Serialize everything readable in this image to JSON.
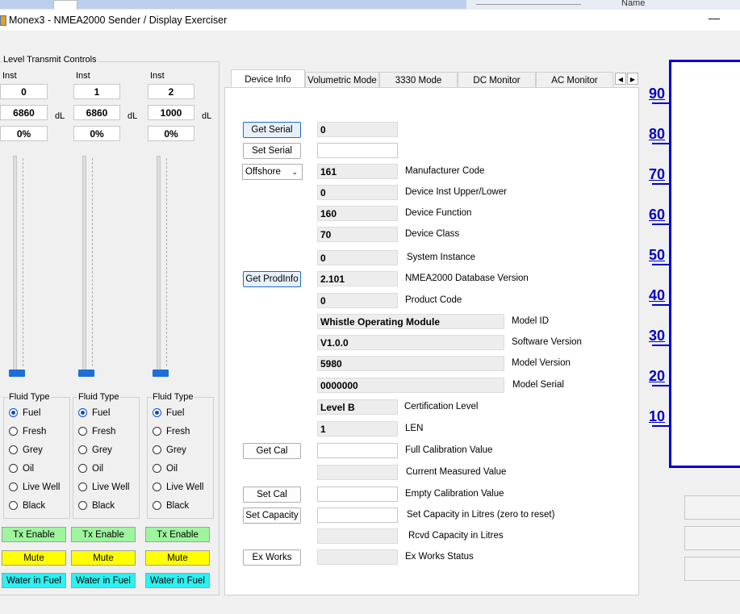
{
  "topbar": {
    "name_header": "Name"
  },
  "window": {
    "title": "Monex3 - NMEA2000 Sender / Display Exerciser",
    "minimize_glyph": "—"
  },
  "level_controls": {
    "group_label": "Level Transmit Controls",
    "unit": "dL",
    "columns": [
      {
        "inst_label": "Inst",
        "inst": "0",
        "level": "6860",
        "percent": "0%",
        "slider_fraction": 0.0,
        "fluid_label": "Fluid Type",
        "selected": "Fuel",
        "tx_label": "Tx Enable",
        "mute_label": "Mute",
        "water_label": "Water in Fuel"
      },
      {
        "inst_label": "Inst",
        "inst": "1",
        "level": "6860",
        "percent": "0%",
        "slider_fraction": 0.0,
        "fluid_label": "Fluid Type",
        "selected": "Fuel",
        "tx_label": "Tx Enable",
        "mute_label": "Mute",
        "water_label": "Water in Fuel"
      },
      {
        "inst_label": "Inst",
        "inst": "2",
        "level": "1000",
        "percent": "0%",
        "slider_fraction": 0.0,
        "fluid_label": "Fluid Type",
        "selected": "Fuel",
        "tx_label": "Tx Enable",
        "mute_label": "Mute",
        "water_label": "Water in Fuel"
      }
    ],
    "fluid_options": [
      "Fuel",
      "Fresh",
      "Grey",
      "Oil",
      "Live Well",
      "Black"
    ],
    "colors": {
      "tx": "#9ef59e",
      "mute": "#ffff00",
      "water": "#2df0f0",
      "slider": "#1a6fd9"
    }
  },
  "tabs": [
    "Device Info",
    "Volumetric Mode",
    "3330 Mode",
    "DC Monitor",
    "AC Monitor"
  ],
  "tab_scroll": {
    "left": "◀",
    "right": "▶"
  },
  "device_info": {
    "buttons": {
      "get_serial": "Get Serial",
      "set_serial": "Set Serial",
      "get_prodinfo": "Get ProdInfo",
      "get_cal": "Get Cal",
      "set_cal": "Set Cal",
      "set_capacity": "Set Capacity",
      "ex_works": "Ex Works"
    },
    "serial_value": "0",
    "serial_input": "",
    "industry_select": "Offshore",
    "fields": [
      {
        "value": "161",
        "label": "Manufacturer Code"
      },
      {
        "value": "0",
        "label": "Device Inst Upper/Lower"
      },
      {
        "value": "160",
        "label": "Device Function"
      },
      {
        "value": "70",
        "label": "Device Class"
      },
      {
        "value": "0",
        "label": "System Instance"
      },
      {
        "value": "2.101",
        "label": "NMEA2000 Database Version"
      },
      {
        "value": "0",
        "label": "Product Code"
      }
    ],
    "product": [
      {
        "value": "Whistle Operating Module",
        "label": "Model ID"
      },
      {
        "value": "V1.0.0",
        "label": "Software Version"
      },
      {
        "value": "5980",
        "label": "Model Version"
      },
      {
        "value": "0000000",
        "label": "Model Serial"
      }
    ],
    "cert": {
      "value": "Level B",
      "label": "Certification Level"
    },
    "len": {
      "value": "1",
      "label": "LEN"
    },
    "calibration": [
      {
        "value": "",
        "label": "Full Calibration Value"
      },
      {
        "value": "",
        "label": "Current Measured Value"
      },
      {
        "value": "",
        "label": "Empty Calibration Value"
      },
      {
        "value": "",
        "label": "Set Capacity in Litres (zero to reset)"
      },
      {
        "value": "",
        "label": "Rcvd Capacity in Litres"
      },
      {
        "value": "",
        "label": "Ex Works Status"
      }
    ]
  },
  "gauge": {
    "ticks": [
      "90",
      "80",
      "70",
      "60",
      "50",
      "40",
      "30",
      "20",
      "10"
    ],
    "color": "#0000c8"
  }
}
